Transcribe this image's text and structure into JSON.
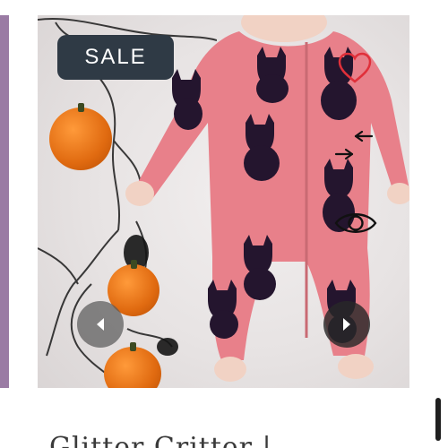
{
  "product": {
    "badge": "SALE",
    "title": "Glitter Critter |"
  },
  "icons": {
    "wishlist": "heart-icon",
    "compare": "compare-arrows-icon",
    "quickview": "eye-icon",
    "prev": "chevron-left-icon",
    "next": "chevron-right-icon"
  },
  "colors": {
    "accent_bar": "#9a7ba4",
    "badge_bg": "#2f3a45",
    "wishlist": "#e0303a",
    "romper": "#e8808a"
  }
}
